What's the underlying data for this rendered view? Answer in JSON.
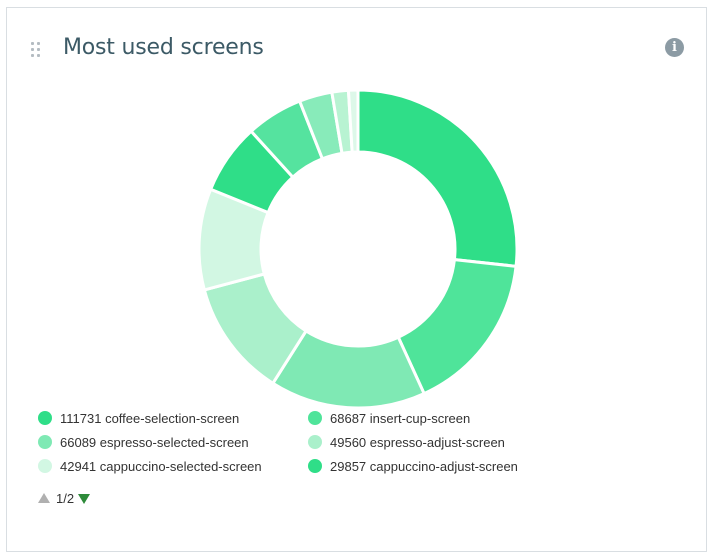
{
  "widget": {
    "title": "Most used screens",
    "info_icon": "info-icon",
    "drag_icon": "drag-handle-icon"
  },
  "chart_data": {
    "type": "pie",
    "donut": true,
    "title": "",
    "slices": [
      {
        "label": "coffee-selection-screen",
        "value": 111731,
        "color": "#2fde88"
      },
      {
        "label": "insert-cup-screen",
        "value": 68687,
        "color": "#4fe49a"
      },
      {
        "label": "espresso-selected-screen",
        "value": 66089,
        "color": "#7fe9b4"
      },
      {
        "label": "espresso-adjust-screen",
        "value": 49560,
        "color": "#aaf0cb"
      },
      {
        "label": "cappuccino-selected-screen",
        "value": 42941,
        "color": "#d2f7e3"
      },
      {
        "label": "cappuccino-adjust-screen",
        "value": 29857,
        "color": "#2fde88"
      },
      {
        "value": 24000,
        "color": "#55e39f"
      },
      {
        "value": 14000,
        "color": "#88ebba"
      },
      {
        "value": 7000,
        "color": "#b8f3d2"
      },
      {
        "value": 4000,
        "color": "#ddf8e9"
      }
    ],
    "legend_placement": "bottom"
  },
  "legend": {
    "items": [
      {
        "value": "111731",
        "label": "coffee-selection-screen",
        "color": "#2fde88"
      },
      {
        "value": "68687",
        "label": "insert-cup-screen",
        "color": "#4fe49a"
      },
      {
        "value": "66089",
        "label": "espresso-selected-screen",
        "color": "#7fe9b4"
      },
      {
        "value": "49560",
        "label": "espresso-adjust-screen",
        "color": "#aaf0cb"
      },
      {
        "value": "42941",
        "label": "cappuccino-selected-screen",
        "color": "#d2f7e3"
      },
      {
        "value": "29857",
        "label": "cappuccino-adjust-screen",
        "color": "#2fde88"
      }
    ],
    "page_text": "1/2"
  }
}
